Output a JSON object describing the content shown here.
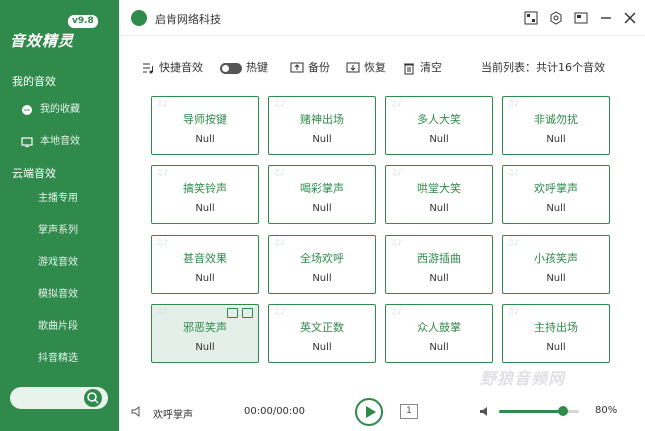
{
  "sidebar": {
    "logo_text": "音效精灵",
    "version": "v9.8",
    "my_sounds": "我的音效",
    "my_items": [
      {
        "label": "我的收藏",
        "icon": "chat-bubble-icon"
      },
      {
        "label": "本地音效",
        "icon": "monitor-icon"
      }
    ],
    "cloud_sounds": "云端音效",
    "cloud_items": [
      "主播专用",
      "掌声系列",
      "游戏音效",
      "模拟音效",
      "歌曲片段",
      "抖音精选"
    ]
  },
  "titlebar": {
    "title": "启肯网络科技",
    "buttons": [
      "qr-code-icon",
      "settings-hex-icon",
      "restore-icon",
      "minimize-icon",
      "close-icon"
    ]
  },
  "toolbar": {
    "shortcut": "快捷音效",
    "hotkey": "热键",
    "backup": "备份",
    "restore": "恢复",
    "clear": "清空",
    "current_list": "当前列表：共计16个音效"
  },
  "cards": [
    {
      "name": "导师按键",
      "value": "Null"
    },
    {
      "name": "赌神出场",
      "value": "Null"
    },
    {
      "name": "多人大笑",
      "value": "Null"
    },
    {
      "name": "非诚勿扰",
      "value": "Null"
    },
    {
      "name": "搞笑铃声",
      "value": "Null"
    },
    {
      "name": "喝彩掌声",
      "value": "Null"
    },
    {
      "name": "哄堂大笑",
      "value": "Null"
    },
    {
      "name": "欢呼掌声",
      "value": "Null"
    },
    {
      "name": "甚音效果",
      "value": "Null"
    },
    {
      "name": "全场欢呼",
      "value": "Null"
    },
    {
      "name": "西游插曲",
      "value": "Null"
    },
    {
      "name": "小孩笑声",
      "value": "Null"
    },
    {
      "name": "邪恶笑声",
      "value": "Null",
      "active": true
    },
    {
      "name": "英文正数",
      "value": "Null"
    },
    {
      "name": "众人鼓掌",
      "value": "Null"
    },
    {
      "name": "主持出场",
      "value": "Null"
    }
  ],
  "player": {
    "now_playing": "欢呼掌声",
    "time": "00:00/00:00",
    "loop_label": "1",
    "volume": 80,
    "volume_text": "80%"
  },
  "colors": {
    "brand": "#2f8a4c"
  }
}
